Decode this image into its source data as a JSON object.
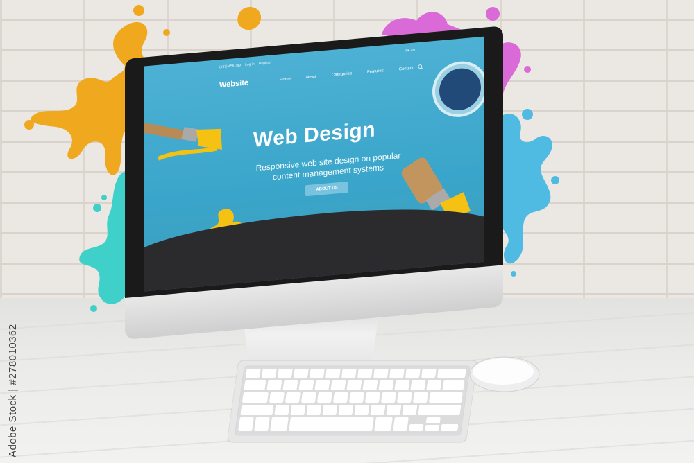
{
  "watermark": "Adobe Stock | #278010362",
  "screen": {
    "topbar_phone": "(123) 456 789",
    "topbar_login": "Log in",
    "topbar_register": "Register",
    "topbar_social": "f  ♥  +N",
    "brand": "Website",
    "nav": [
      "Home",
      "News",
      "Categories",
      "Features",
      "Contact"
    ],
    "hero_title": "Web Design",
    "hero_subtitle": "Responsive web site design on popular content management systems",
    "about_button": "ABOUT US"
  },
  "colors": {
    "screen_blue": "#4db1d4",
    "orange_paint": "#f0a81f",
    "pink_paint": "#d96ad8",
    "cyan_paint": "#3fd0c9",
    "blue_paint": "#4fbbe3",
    "yellow_paint": "#f5c214"
  },
  "icons": [
    "search-icon",
    "paint-brush-icon",
    "paint-can-icon"
  ]
}
